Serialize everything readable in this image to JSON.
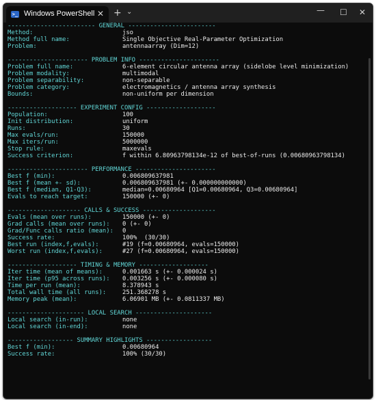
{
  "window": {
    "title": "Windows PowerShell",
    "icons": {
      "app": "powershell-icon",
      "close_tab": "close-icon",
      "new_tab": "plus-icon",
      "dropdown": "chevron-down-icon",
      "minimize": "minimize-icon",
      "maximize": "maximize-icon",
      "close": "close-icon"
    },
    "glyphs": {
      "app_icon": ">_",
      "tab_close": "✕",
      "new_tab": "+",
      "dropdown": "⌄",
      "minimize": "—",
      "maximize": "☐",
      "close": "✕"
    }
  },
  "colors": {
    "background": "#0c0c0c",
    "label": "#61d6d6",
    "value": "#ececec",
    "titlebar": "#202020"
  },
  "sections": [
    {
      "header": "------------------------ GENERAL ------------------------",
      "rows": [
        {
          "label": "Method:",
          "value": "jso"
        },
        {
          "label": "Method full name:",
          "value": "Single Objective Real-Parameter Optimization"
        },
        {
          "label": "Problem:",
          "value": "antennaarray (Dim=12)"
        }
      ]
    },
    {
      "header": "---------------------- PROBLEM INFO ----------------------",
      "rows": [
        {
          "label": "Problem full name:",
          "value": "6-element circular antenna array (sidelobe level minimization)"
        },
        {
          "label": "Problem modality:",
          "value": "multimodal"
        },
        {
          "label": "Problem separability:",
          "value": "non-separable"
        },
        {
          "label": "Problem category:",
          "value": "electromagnetics / antenna array synthesis"
        },
        {
          "label": "Bounds:",
          "value": "non-uniform per dimension"
        }
      ]
    },
    {
      "header": "------------------- EXPERIMENT CONFIG -------------------",
      "rows": [
        {
          "label": "Population:",
          "value": "100"
        },
        {
          "label": "Init distribution:",
          "value": "uniform"
        },
        {
          "label": "Runs:",
          "value": "30"
        },
        {
          "label": "Max evals/run:",
          "value": "150000"
        },
        {
          "label": "Max iters/run:",
          "value": "5000000"
        },
        {
          "label": "Stop rule:",
          "value": "maxevals"
        },
        {
          "label": "Success criterion:",
          "value": "f within 6.80963798134e-12 of best-of-runs (0.00680963798134)"
        }
      ]
    },
    {
      "header": "---------------------- PERFORMANCE ----------------------",
      "rows": [
        {
          "label": "Best f (min):",
          "value": "0.006809637981"
        },
        {
          "label": "Best f (mean +- sd):",
          "value": "0.006809637981 (+- 0.000000000000)"
        },
        {
          "label": "Best f (median, Q1-Q3):",
          "value": "median=0.00680964 [Q1=0.00680964, Q3=0.00680964]"
        },
        {
          "label": "Evals to reach target:",
          "value": "150000 (+- 0)"
        }
      ]
    },
    {
      "header": "-------------------- CALLS & SUCCESS --------------------",
      "rows": [
        {
          "label": "Evals (mean over runs):",
          "value": "150000 (+- 0)"
        },
        {
          "label": "Grad calls (mean over runs):",
          "value": "0 (+- 0)"
        },
        {
          "label": "Grad/Func calls ratio (mean):",
          "value": "0"
        },
        {
          "label": "Success rate:",
          "value": "100%  (30/30)"
        },
        {
          "label": "Best run (index,f,evals):",
          "value": "#19 (f=0.00680964, evals=150000)"
        },
        {
          "label": "Worst run (index,f,evals):",
          "value": "#27 (f=0.00680964, evals=150000)"
        }
      ]
    },
    {
      "header": "------------------- TIMING & MEMORY -------------------",
      "rows": [
        {
          "label": "Iter time (mean of means):",
          "value": "0.001663 s (+- 0.000024 s)"
        },
        {
          "label": "Iter time (p95 across runs):",
          "value": "0.003256 s (+- 0.000080 s)"
        },
        {
          "label": "Time per run (mean):",
          "value": "8.378943 s"
        },
        {
          "label": "Total wall time (all runs):",
          "value": "251.368278 s"
        },
        {
          "label": "Memory peak (mean):",
          "value": "6.06901 MB (+- 0.0811337 MB)"
        }
      ]
    },
    {
      "header": "--------------------- LOCAL SEARCH ---------------------",
      "rows": [
        {
          "label": "Local search (in-run):",
          "value": "none"
        },
        {
          "label": "Local search (in-end):",
          "value": "none"
        }
      ]
    },
    {
      "header": "------------------ SUMMARY HIGHLIGHTS ------------------",
      "rows": [
        {
          "label": "Best f (min):",
          "value": "0.00680964"
        },
        {
          "label": "Success rate:",
          "value": "100% (30/30)"
        }
      ]
    }
  ]
}
